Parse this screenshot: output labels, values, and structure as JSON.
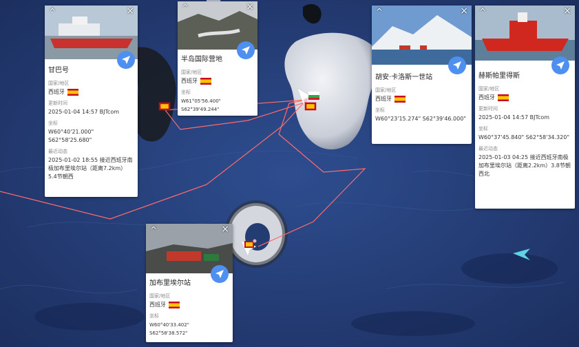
{
  "colors": {
    "ocean": "#1f3466",
    "route": "#ff6b6b",
    "nav_button": "#4e8ff0",
    "spain_red": "#c60b1e",
    "spain_yellow": "#ffc400"
  },
  "labels": {
    "region": "国家/地区",
    "updated": "更新时间",
    "coords": "坐标",
    "latest": "最近动态"
  },
  "cards": {
    "ganba": {
      "name": "甘巴号",
      "country": "西班牙",
      "updated": "2025-01-04 14:57 BJTcom",
      "coords": "W60°40'21.000\" S62°58'25.680\"",
      "latest": "2025-01-02 18:55 接近西班牙南极加布里埃尔站（距离7.2km）5.4节朝西"
    },
    "peninsula": {
      "name": "半岛国际营地",
      "country": "西班牙",
      "coords": "W61°05'56.400\" S62°39'49.244\""
    },
    "juan": {
      "name": "胡安·卡洛斯一世站",
      "country": "西班牙",
      "coords": "W60°23'15.274\" S62°39'46.000\""
    },
    "hesperides": {
      "name": "赫斯帕里得斯",
      "country": "西班牙",
      "updated": "2025-01-04 14:57 BJTcom",
      "coords": "W60°37'45.840\" S62°58'34.320\"",
      "latest": "2025-01-03 04:25 接近西班牙南极加布里埃尔站（距离2.2km）3.8节朝西北"
    },
    "gabriel": {
      "name": "加布里埃尔站",
      "country": "西班牙",
      "coords": "W60°40'33.402\" S62°58'38.572\""
    }
  },
  "icons": {
    "expand": "chevron-up-icon",
    "close": "close-icon",
    "navigate": "paper-plane-icon",
    "flag": "spain-flag-icon",
    "ship": "ship-marker-icon",
    "station": "station-marker-icon"
  }
}
